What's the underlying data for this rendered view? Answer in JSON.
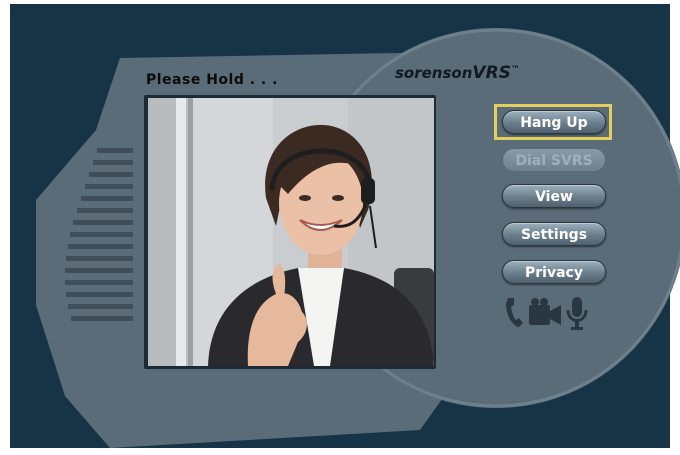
{
  "window": {
    "status_text": "Please Hold . . .",
    "brand": {
      "part_a": "sorenson",
      "part_b": "VRS",
      "trademark": "™"
    }
  },
  "controls": {
    "buttons": [
      {
        "label": "Hang Up",
        "enabled": true,
        "focused": true
      },
      {
        "label": "Dial SVRS",
        "enabled": false,
        "focused": false
      },
      {
        "label": "View",
        "enabled": true,
        "focused": false
      },
      {
        "label": "Settings",
        "enabled": true,
        "focused": false
      },
      {
        "label": "Privacy",
        "enabled": true,
        "focused": false
      }
    ],
    "focus_color": "#e4cf5c"
  },
  "status_icons": [
    "phone-icon",
    "video-camera-icon",
    "microphone-icon"
  ],
  "colors": {
    "backdrop": "#173447",
    "panel": "#5c6d7a",
    "button": "#6b7e8c",
    "icon": "#2a3640"
  }
}
